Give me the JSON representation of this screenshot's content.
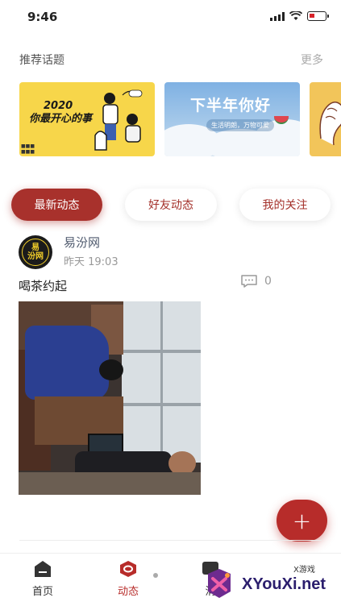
{
  "status_bar": {
    "time": "9:46"
  },
  "topics_section": {
    "title": "推荐话题",
    "more": "更多",
    "cards": [
      {
        "text_line1": "2020",
        "text_line2": "你最开心的事"
      },
      {
        "title": "下半年你好",
        "subtitle": "生活明朗，万物可爱"
      },
      {
        "text": ""
      }
    ]
  },
  "tabs": [
    {
      "label": "最新动态"
    },
    {
      "label": "好友动态"
    },
    {
      "label": "我的关注"
    }
  ],
  "post": {
    "avatar_text_line1": "易",
    "avatar_text_line2": "汾网",
    "author": "易汾网",
    "time": "昨天 19:03",
    "text": "喝茶约起",
    "comment_count": "0"
  },
  "fab": {
    "label": "+"
  },
  "bottom_nav": [
    {
      "label": "首页"
    },
    {
      "label": "动态"
    },
    {
      "label": "消"
    }
  ],
  "watermark": {
    "brand": "XYouXi.net",
    "tag": "X游戏"
  },
  "colors": {
    "accent": "#b72c2a",
    "tab_active": "#a8312c"
  }
}
